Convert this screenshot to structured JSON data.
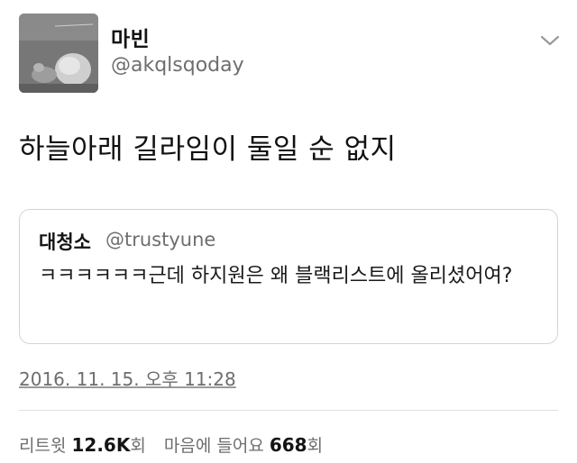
{
  "author": {
    "display_name": "마빈",
    "handle": "@akqlsqoday",
    "avatar_icon": "profile-photo"
  },
  "menu": {
    "icon": "chevron-down-icon"
  },
  "tweet": {
    "text": "하늘아래 길라임이 둘일 순 없지"
  },
  "quoted": {
    "display_name": "대청소",
    "handle": "@trustyune",
    "text": "ㅋㅋㅋㅋㅋㅋ근데 하지원은 왜 블랙리스트에 올리셨어여?"
  },
  "timestamp": "2016. 11. 15. 오후 11:28",
  "stats": {
    "retweets_label": "리트윗",
    "retweets_count": "12.6K",
    "retweets_unit": "회",
    "likes_label": "마음에 들어요",
    "likes_count": "668",
    "likes_unit": "회"
  },
  "colors": {
    "text": "#141414",
    "secondary": "#6e6e6e",
    "border": "#d4d4d4"
  }
}
